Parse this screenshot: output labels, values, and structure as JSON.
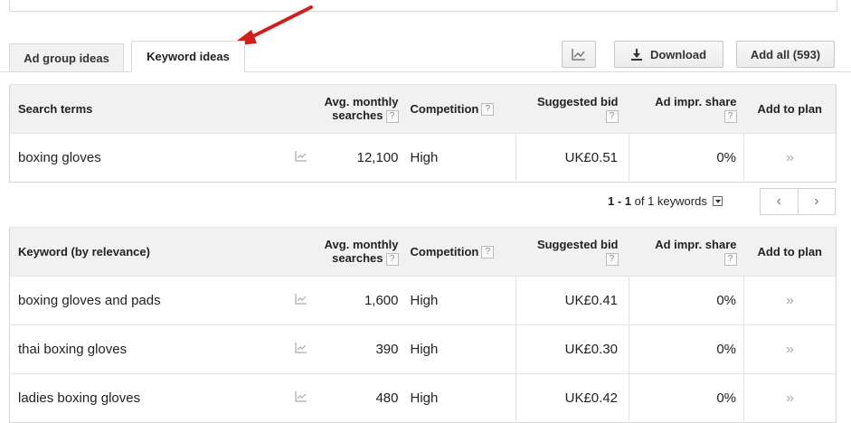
{
  "tabs": [
    {
      "label": "Ad group ideas",
      "active": false
    },
    {
      "label": "Keyword ideas",
      "active": true
    }
  ],
  "toolbar": {
    "chart_icon": "line-chart-icon",
    "download_label": "Download",
    "add_all_label": "Add all (593)"
  },
  "columns": {
    "avg_monthly_searches": "Avg. monthly searches",
    "competition": "Competition",
    "suggested_bid": "Suggested bid",
    "ad_impr_share": "Ad impr. share",
    "add_to_plan": "Add to plan",
    "help_glyph": "?"
  },
  "search_terms_table": {
    "first_column": "Search terms",
    "rows": [
      {
        "keyword": "boxing gloves",
        "searches": "12,100",
        "competition": "High",
        "bid": "UK£0.51",
        "share": "0%",
        "add": "»"
      }
    ]
  },
  "pagination": {
    "range": "1 - 1",
    "suffix": "of 1 keywords",
    "prev": "‹",
    "next": "›"
  },
  "keyword_ideas_table": {
    "first_column": "Keyword (by relevance)",
    "rows": [
      {
        "keyword": "boxing gloves and pads",
        "searches": "1,600",
        "competition": "High",
        "bid": "UK£0.41",
        "share": "0%",
        "add": "»"
      },
      {
        "keyword": "thai boxing gloves",
        "searches": "390",
        "competition": "High",
        "bid": "UK£0.30",
        "share": "0%",
        "add": "»"
      },
      {
        "keyword": "ladies boxing gloves",
        "searches": "480",
        "competition": "High",
        "bid": "UK£0.42",
        "share": "0%",
        "add": "»"
      }
    ]
  },
  "colors": {
    "annotation_arrow": "#d0201c",
    "header_bg": "#f1f1f1",
    "border": "#d9d9d9"
  }
}
